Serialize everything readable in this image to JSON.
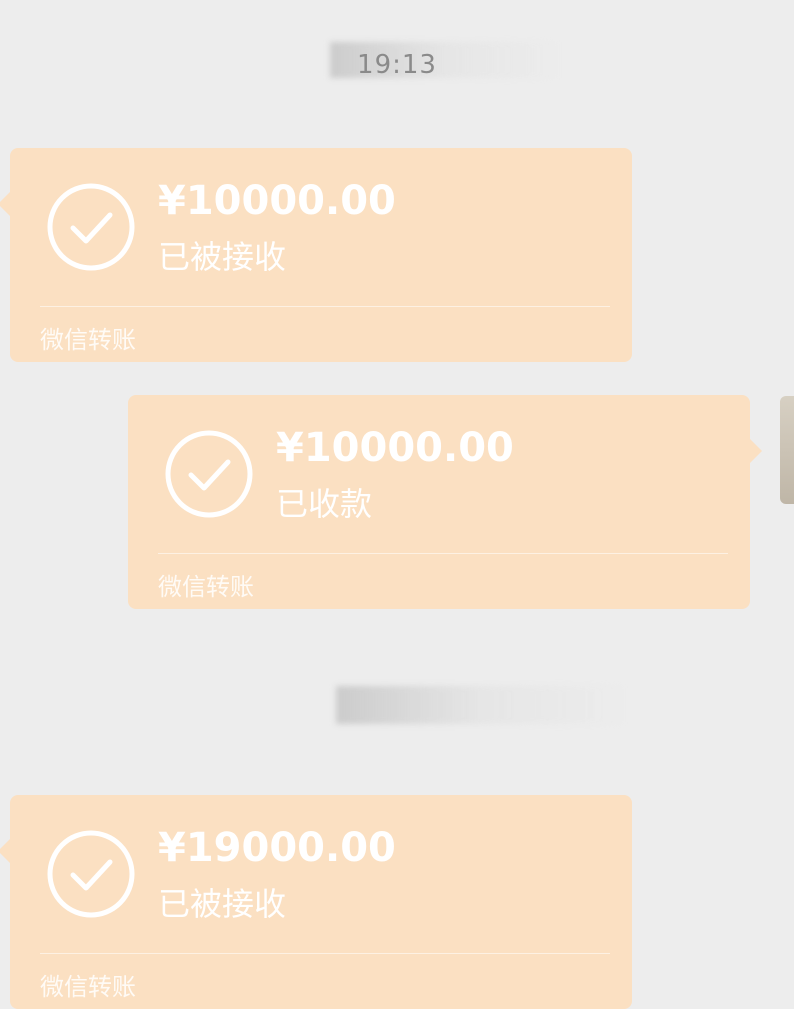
{
  "chat": {
    "timestamp_1": "19:13",
    "timestamp_2": "",
    "messages": [
      {
        "direction": "incoming",
        "amount": "¥10000.00",
        "status": "已被接收",
        "footer": "微信转账"
      },
      {
        "direction": "outgoing",
        "amount": "¥10000.00",
        "status": "已收款",
        "footer": "微信转账"
      },
      {
        "direction": "incoming",
        "amount": "¥19000.00",
        "status": "已被接收",
        "footer": "微信转账"
      }
    ]
  },
  "icons": {
    "transfer_status": "check-circle-icon"
  },
  "colors": {
    "background": "#ededed",
    "transfer_card": "#fbe0c2",
    "card_text": "#ffffff",
    "timestamp_text": "#8a8a8a"
  }
}
